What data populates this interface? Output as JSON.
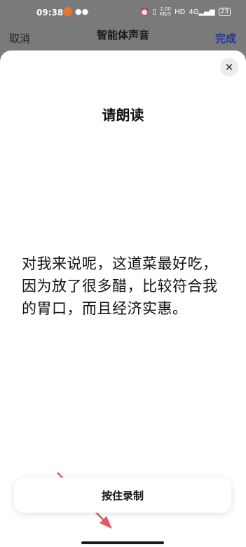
{
  "status_bar": {
    "time": "09:38",
    "net_speed_value": "2.00",
    "net_speed_unit": "KB/S",
    "hd_label": "HD",
    "signal_label": "4G",
    "battery": "23"
  },
  "nav": {
    "cancel_label": "取消",
    "title": "智能体声音",
    "done_label": "完成"
  },
  "sheet": {
    "close_symbol": "✕",
    "title": "请朗读",
    "read_text": "对我来说呢，这道菜最好吃，因为放了很多醋，比较符合我的胃口，而且经济实惠。",
    "record_button_label": "按住录制"
  },
  "colors": {
    "accent": "#233b9a",
    "arrow": "#e05a6a"
  }
}
